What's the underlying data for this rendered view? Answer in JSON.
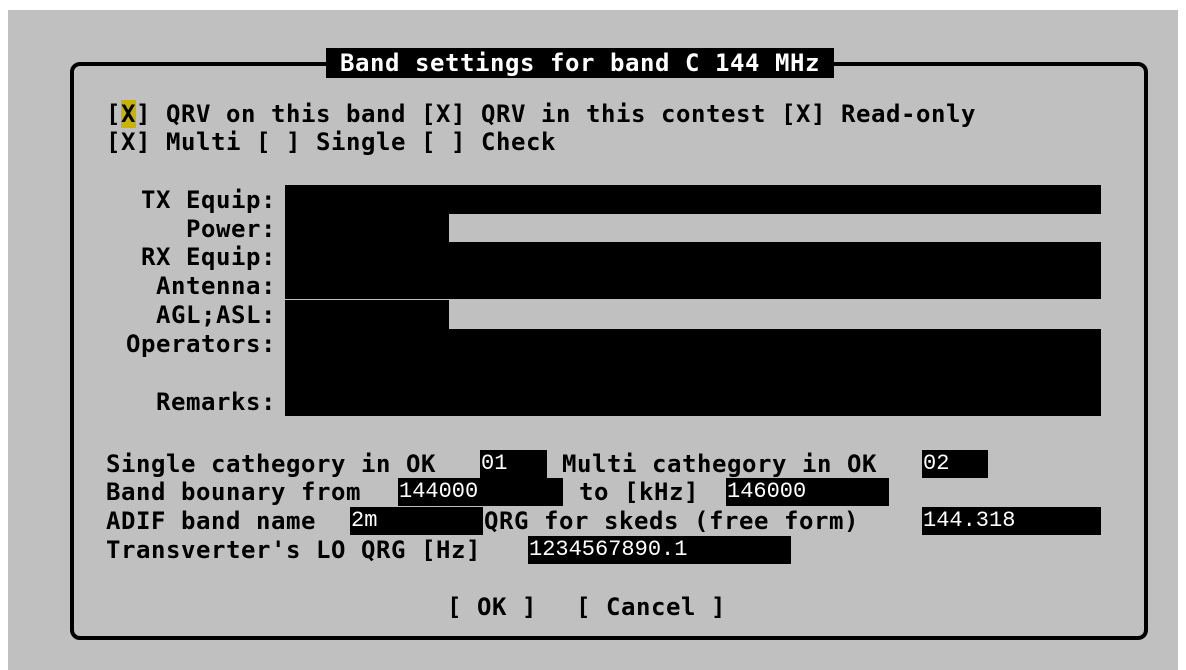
{
  "dialog": {
    "title": "Band settings for band C 144 MHz"
  },
  "checkboxes": {
    "qrv_band": {
      "mark": "X",
      "label": " QRV on this band"
    },
    "qrv_contest": {
      "mark": "X",
      "label": " QRV in this contest"
    },
    "read_only": {
      "mark": "X",
      "label": " Read-only"
    },
    "multi": {
      "mark": "X",
      "label": " Multi"
    },
    "single": {
      "mark": " ",
      "label": " Single"
    },
    "check": {
      "mark": " ",
      "label": " Check"
    }
  },
  "equipment": {
    "tx_equip": {
      "label": "TX Equip:",
      "value": ""
    },
    "power": {
      "label": "Power:",
      "value": ""
    },
    "rx_equip": {
      "label": "RX Equip:",
      "value": ""
    },
    "antenna": {
      "label": "Antenna:",
      "value": ""
    },
    "agl_asl": {
      "label": "AGL;ASL:",
      "value": ""
    },
    "operators": {
      "label": "Operators:",
      "value": ""
    },
    "remarks": {
      "label": "Remarks:",
      "value": ""
    }
  },
  "category": {
    "single_label": "Single cathegory in OK",
    "single_value": "01",
    "multi_label": "Multi cathegory in OK",
    "multi_value": "02"
  },
  "boundary": {
    "from_label": "Band bounary from",
    "from_value": "144000",
    "to_label": "to [kHz]",
    "to_value": "146000"
  },
  "adif": {
    "label": "ADIF band name",
    "value": "2m",
    "qrg_label": "QRG for skeds (free form)",
    "qrg_value": "144.318"
  },
  "transverter": {
    "label": "Transverter's LO QRG [Hz]",
    "value": "1234567890.1"
  },
  "buttons": {
    "ok": "[ OK ]",
    "cancel": "[ Cancel ]"
  },
  "colors": {
    "background": "#c0c0c0",
    "field": "#000000",
    "field_text": "#ffffff",
    "cursor": "#c8b400"
  }
}
